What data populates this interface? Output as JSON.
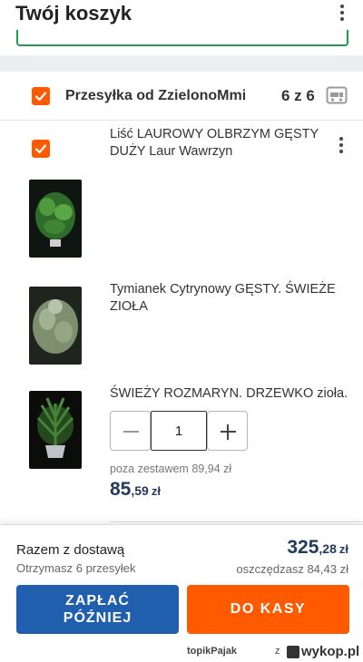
{
  "header": {
    "title": "Twój koszyk",
    "menu_icon": "more-vert-icon"
  },
  "shipment": {
    "label": "Przesyłka od ZzielonoMmi",
    "count": "6 z 6",
    "icon": "truck-icon",
    "checked": true
  },
  "items": [
    {
      "title": "Liść LAUROWY OLBRZYM GĘSTY DUŻY Laur Wawrzyn",
      "checked": true,
      "menu_icon": "more-vert-icon"
    },
    {
      "title": "Tymianek Cytrynowy GĘSTY. ŚWIEŻE ZIOŁA"
    },
    {
      "title": "ŚWIEŻY ROZMARYN. DRZEWKO zioła.",
      "quantity": "1",
      "outside_set_price": "poza zestawem 89,94 zł",
      "price": {
        "main": "85",
        "decimals": ",59",
        "currency": "zł"
      }
    }
  ],
  "footer": {
    "total_label": "Razem z dostawą",
    "shipments_label": "Otrzymasz 6 przesyłek",
    "total": {
      "main": "325",
      "decimals": ",28",
      "currency": "zł"
    },
    "savings": "oszczędzasz 84,43 zł",
    "pay_later_line1": "ZAPŁAĆ",
    "pay_later_line2": "PÓŹNIEJ",
    "checkout_label": "DO KASY"
  },
  "watermark": {
    "user": "topikPajak",
    "sep": "z",
    "brand": "wykop.pl"
  },
  "colors": {
    "accent": "#ff5a00",
    "primary_blue": "#1f5fae",
    "price_navy": "#1f3a5c",
    "border_green": "#1f9c4e"
  }
}
